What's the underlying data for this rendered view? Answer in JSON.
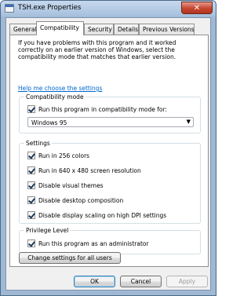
{
  "window": {
    "title": "TSH.exe Properties",
    "close_label": "✕"
  },
  "tabs": [
    {
      "label": "General",
      "active": false
    },
    {
      "label": "Compatibility",
      "active": true
    },
    {
      "label": "Security",
      "active": false
    },
    {
      "label": "Details",
      "active": false
    },
    {
      "label": "Previous Versions",
      "active": false
    }
  ],
  "panel": {
    "intro_text": "If you have problems with this program and it worked correctly on an earlier version of Windows, select the compatibility mode that matches that earlier version.",
    "help_link": "Help me choose the settings",
    "compat_group": {
      "legend": "Compatibility mode",
      "checkbox_label": "Run this program in compatibility mode for:",
      "checked": true,
      "select_value": "Windows 95"
    },
    "settings_group": {
      "legend": "Settings",
      "items": [
        {
          "label": "Run in 256 colors",
          "checked": true
        },
        {
          "label": "Run in 640 x 480 screen resolution",
          "checked": true
        },
        {
          "label": "Disable visual themes",
          "checked": true
        },
        {
          "label": "Disable desktop composition",
          "checked": true
        },
        {
          "label": "Disable display scaling on high DPI settings",
          "checked": true
        }
      ]
    },
    "privilege_group": {
      "legend": "Privilege Level",
      "checkbox_label": "Run this program as an administrator",
      "checked": true
    },
    "change_all_button": "Change settings for all users"
  },
  "footer": {
    "ok": "OK",
    "cancel": "Cancel",
    "apply": "Apply"
  }
}
